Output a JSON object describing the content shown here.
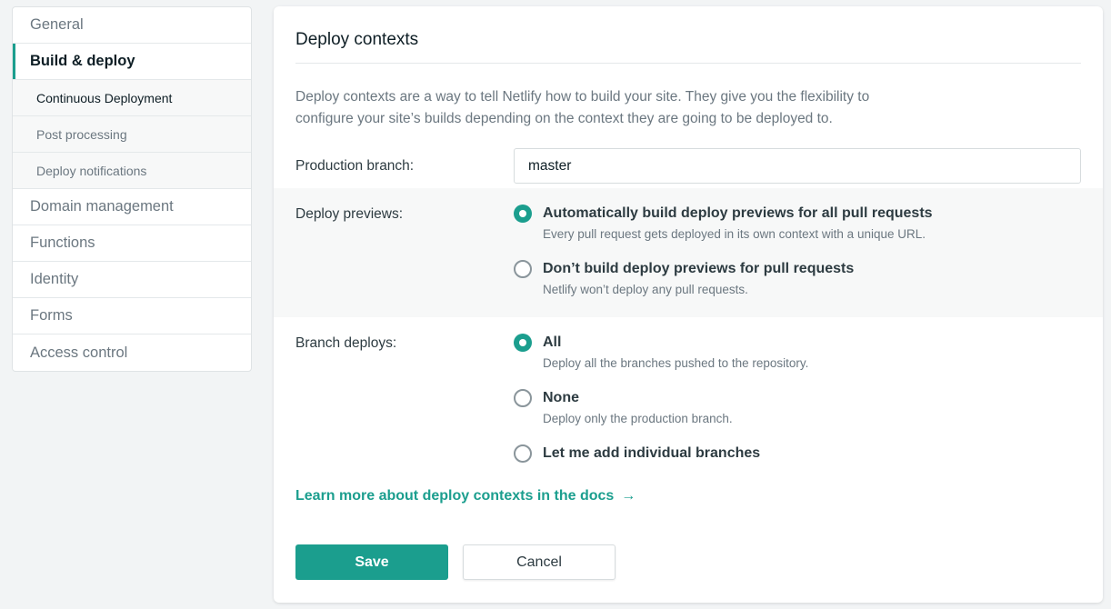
{
  "sidebar": {
    "items": [
      {
        "label": "General"
      },
      {
        "label": "Build & deploy"
      },
      {
        "label": "Domain management"
      },
      {
        "label": "Functions"
      },
      {
        "label": "Identity"
      },
      {
        "label": "Forms"
      },
      {
        "label": "Access control"
      }
    ],
    "subitems": [
      {
        "label": "Continuous Deployment"
      },
      {
        "label": "Post processing"
      },
      {
        "label": "Deploy notifications"
      }
    ]
  },
  "main": {
    "title": "Deploy contexts",
    "description": "Deploy contexts are a way to tell Netlify how to build your site. They give you the flexibility to configure your site’s builds depending on the context they are going to be deployed to.",
    "production_branch": {
      "label": "Production branch:",
      "value": "master"
    },
    "deploy_previews": {
      "label": "Deploy previews:",
      "options": [
        {
          "label": "Automatically build deploy previews for all pull requests",
          "help": "Every pull request gets deployed in its own context with a unique URL.",
          "checked": true
        },
        {
          "label": "Don’t build deploy previews for pull requests",
          "help": "Netlify won’t deploy any pull requests.",
          "checked": false
        }
      ]
    },
    "branch_deploys": {
      "label": "Branch deploys:",
      "options": [
        {
          "label": "All",
          "help": "Deploy all the branches pushed to the repository.",
          "checked": true
        },
        {
          "label": "None",
          "help": "Deploy only the production branch.",
          "checked": false
        },
        {
          "label": "Let me add individual branches",
          "help": "",
          "checked": false
        }
      ]
    },
    "learn_more": {
      "label": "Learn more about deploy contexts in the docs",
      "arrow": "→"
    },
    "buttons": {
      "save": "Save",
      "cancel": "Cancel"
    }
  },
  "colors": {
    "accent": "#1b9e8e",
    "background": "#f2f4f5"
  }
}
